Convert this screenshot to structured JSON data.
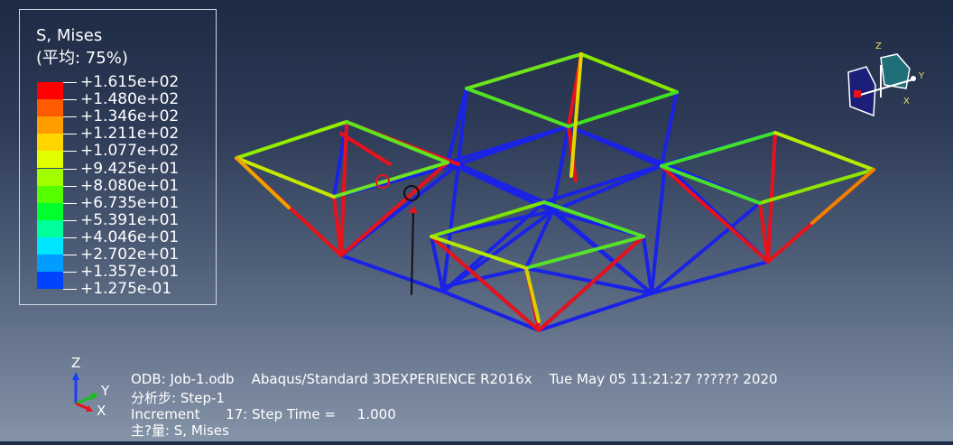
{
  "legend": {
    "title": "S, Mises",
    "subtitle": "(平均: 75%)",
    "levels": [
      {
        "value": "+1.615e+02",
        "color": "#ff0000"
      },
      {
        "value": "+1.480e+02",
        "color": "#ff5a00"
      },
      {
        "value": "+1.346e+02",
        "color": "#ff9c00"
      },
      {
        "value": "+1.211e+02",
        "color": "#ffd500"
      },
      {
        "value": "+1.077e+02",
        "color": "#e4ff00"
      },
      {
        "value": "+9.425e+01",
        "color": "#a2ff00"
      },
      {
        "value": "+8.080e+01",
        "color": "#55ff00"
      },
      {
        "value": "+6.735e+01",
        "color": "#00ff2e"
      },
      {
        "value": "+5.391e+01",
        "color": "#00ff9a"
      },
      {
        "value": "+4.046e+01",
        "color": "#00e5ff"
      },
      {
        "value": "+2.702e+01",
        "color": "#009cff"
      },
      {
        "value": "+1.357e+01",
        "color": "#0044ff"
      },
      {
        "value": "+1.275e-01",
        "color": ""
      }
    ]
  },
  "info": {
    "odb": "ODB: Job-1.odb    Abaqus/Standard 3DEXPERIENCE R2016x    Tue May 05 11:21:27 ?????? 2020",
    "step": "分析步: Step-1",
    "increment": "Increment      17: Step Time =     1.000",
    "variable": "主?量: S, Mises"
  },
  "triad": {
    "z": "Z",
    "y": "Y",
    "x": "X"
  },
  "view_cube": {
    "z": "Z",
    "y": "Y",
    "x": "X"
  }
}
